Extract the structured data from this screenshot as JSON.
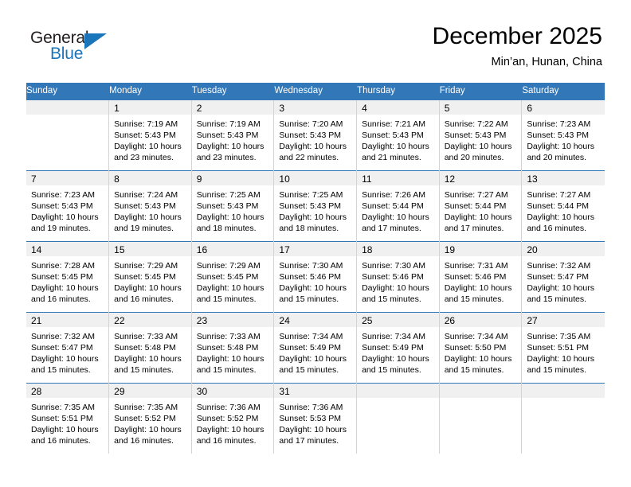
{
  "logo": {
    "text_general": "General",
    "text_blue": "Blue",
    "triangle_color": "#1b75bb"
  },
  "header": {
    "title": "December 2025",
    "subtitle": "Min’an, Hunan, China"
  },
  "theme": {
    "header_row_bg": "#3277b8",
    "daynum_band_bg": "#f0f0f0",
    "grid_line": "#d4d4d4",
    "text": "#000000"
  },
  "weekdays": [
    "Sunday",
    "Monday",
    "Tuesday",
    "Wednesday",
    "Thursday",
    "Friday",
    "Saturday"
  ],
  "weeks": [
    [
      {
        "day": "",
        "sunrise": "",
        "sunset": "",
        "daylight1": "",
        "daylight2": "",
        "empty": true
      },
      {
        "day": "1",
        "sunrise": "Sunrise: 7:19 AM",
        "sunset": "Sunset: 5:43 PM",
        "daylight1": "Daylight: 10 hours",
        "daylight2": "and 23 minutes."
      },
      {
        "day": "2",
        "sunrise": "Sunrise: 7:19 AM",
        "sunset": "Sunset: 5:43 PM",
        "daylight1": "Daylight: 10 hours",
        "daylight2": "and 23 minutes."
      },
      {
        "day": "3",
        "sunrise": "Sunrise: 7:20 AM",
        "sunset": "Sunset: 5:43 PM",
        "daylight1": "Daylight: 10 hours",
        "daylight2": "and 22 minutes."
      },
      {
        "day": "4",
        "sunrise": "Sunrise: 7:21 AM",
        "sunset": "Sunset: 5:43 PM",
        "daylight1": "Daylight: 10 hours",
        "daylight2": "and 21 minutes."
      },
      {
        "day": "5",
        "sunrise": "Sunrise: 7:22 AM",
        "sunset": "Sunset: 5:43 PM",
        "daylight1": "Daylight: 10 hours",
        "daylight2": "and 20 minutes."
      },
      {
        "day": "6",
        "sunrise": "Sunrise: 7:23 AM",
        "sunset": "Sunset: 5:43 PM",
        "daylight1": "Daylight: 10 hours",
        "daylight2": "and 20 minutes."
      }
    ],
    [
      {
        "day": "7",
        "sunrise": "Sunrise: 7:23 AM",
        "sunset": "Sunset: 5:43 PM",
        "daylight1": "Daylight: 10 hours",
        "daylight2": "and 19 minutes."
      },
      {
        "day": "8",
        "sunrise": "Sunrise: 7:24 AM",
        "sunset": "Sunset: 5:43 PM",
        "daylight1": "Daylight: 10 hours",
        "daylight2": "and 19 minutes."
      },
      {
        "day": "9",
        "sunrise": "Sunrise: 7:25 AM",
        "sunset": "Sunset: 5:43 PM",
        "daylight1": "Daylight: 10 hours",
        "daylight2": "and 18 minutes."
      },
      {
        "day": "10",
        "sunrise": "Sunrise: 7:25 AM",
        "sunset": "Sunset: 5:43 PM",
        "daylight1": "Daylight: 10 hours",
        "daylight2": "and 18 minutes."
      },
      {
        "day": "11",
        "sunrise": "Sunrise: 7:26 AM",
        "sunset": "Sunset: 5:44 PM",
        "daylight1": "Daylight: 10 hours",
        "daylight2": "and 17 minutes."
      },
      {
        "day": "12",
        "sunrise": "Sunrise: 7:27 AM",
        "sunset": "Sunset: 5:44 PM",
        "daylight1": "Daylight: 10 hours",
        "daylight2": "and 17 minutes."
      },
      {
        "day": "13",
        "sunrise": "Sunrise: 7:27 AM",
        "sunset": "Sunset: 5:44 PM",
        "daylight1": "Daylight: 10 hours",
        "daylight2": "and 16 minutes."
      }
    ],
    [
      {
        "day": "14",
        "sunrise": "Sunrise: 7:28 AM",
        "sunset": "Sunset: 5:45 PM",
        "daylight1": "Daylight: 10 hours",
        "daylight2": "and 16 minutes."
      },
      {
        "day": "15",
        "sunrise": "Sunrise: 7:29 AM",
        "sunset": "Sunset: 5:45 PM",
        "daylight1": "Daylight: 10 hours",
        "daylight2": "and 16 minutes."
      },
      {
        "day": "16",
        "sunrise": "Sunrise: 7:29 AM",
        "sunset": "Sunset: 5:45 PM",
        "daylight1": "Daylight: 10 hours",
        "daylight2": "and 15 minutes."
      },
      {
        "day": "17",
        "sunrise": "Sunrise: 7:30 AM",
        "sunset": "Sunset: 5:46 PM",
        "daylight1": "Daylight: 10 hours",
        "daylight2": "and 15 minutes."
      },
      {
        "day": "18",
        "sunrise": "Sunrise: 7:30 AM",
        "sunset": "Sunset: 5:46 PM",
        "daylight1": "Daylight: 10 hours",
        "daylight2": "and 15 minutes."
      },
      {
        "day": "19",
        "sunrise": "Sunrise: 7:31 AM",
        "sunset": "Sunset: 5:46 PM",
        "daylight1": "Daylight: 10 hours",
        "daylight2": "and 15 minutes."
      },
      {
        "day": "20",
        "sunrise": "Sunrise: 7:32 AM",
        "sunset": "Sunset: 5:47 PM",
        "daylight1": "Daylight: 10 hours",
        "daylight2": "and 15 minutes."
      }
    ],
    [
      {
        "day": "21",
        "sunrise": "Sunrise: 7:32 AM",
        "sunset": "Sunset: 5:47 PM",
        "daylight1": "Daylight: 10 hours",
        "daylight2": "and 15 minutes."
      },
      {
        "day": "22",
        "sunrise": "Sunrise: 7:33 AM",
        "sunset": "Sunset: 5:48 PM",
        "daylight1": "Daylight: 10 hours",
        "daylight2": "and 15 minutes."
      },
      {
        "day": "23",
        "sunrise": "Sunrise: 7:33 AM",
        "sunset": "Sunset: 5:48 PM",
        "daylight1": "Daylight: 10 hours",
        "daylight2": "and 15 minutes."
      },
      {
        "day": "24",
        "sunrise": "Sunrise: 7:34 AM",
        "sunset": "Sunset: 5:49 PM",
        "daylight1": "Daylight: 10 hours",
        "daylight2": "and 15 minutes."
      },
      {
        "day": "25",
        "sunrise": "Sunrise: 7:34 AM",
        "sunset": "Sunset: 5:49 PM",
        "daylight1": "Daylight: 10 hours",
        "daylight2": "and 15 minutes."
      },
      {
        "day": "26",
        "sunrise": "Sunrise: 7:34 AM",
        "sunset": "Sunset: 5:50 PM",
        "daylight1": "Daylight: 10 hours",
        "daylight2": "and 15 minutes."
      },
      {
        "day": "27",
        "sunrise": "Sunrise: 7:35 AM",
        "sunset": "Sunset: 5:51 PM",
        "daylight1": "Daylight: 10 hours",
        "daylight2": "and 15 minutes."
      }
    ],
    [
      {
        "day": "28",
        "sunrise": "Sunrise: 7:35 AM",
        "sunset": "Sunset: 5:51 PM",
        "daylight1": "Daylight: 10 hours",
        "daylight2": "and 16 minutes."
      },
      {
        "day": "29",
        "sunrise": "Sunrise: 7:35 AM",
        "sunset": "Sunset: 5:52 PM",
        "daylight1": "Daylight: 10 hours",
        "daylight2": "and 16 minutes."
      },
      {
        "day": "30",
        "sunrise": "Sunrise: 7:36 AM",
        "sunset": "Sunset: 5:52 PM",
        "daylight1": "Daylight: 10 hours",
        "daylight2": "and 16 minutes."
      },
      {
        "day": "31",
        "sunrise": "Sunrise: 7:36 AM",
        "sunset": "Sunset: 5:53 PM",
        "daylight1": "Daylight: 10 hours",
        "daylight2": "and 17 minutes."
      },
      {
        "day": "",
        "sunrise": "",
        "sunset": "",
        "daylight1": "",
        "daylight2": "",
        "empty": true
      },
      {
        "day": "",
        "sunrise": "",
        "sunset": "",
        "daylight1": "",
        "daylight2": "",
        "empty": true
      },
      {
        "day": "",
        "sunrise": "",
        "sunset": "",
        "daylight1": "",
        "daylight2": "",
        "empty": true
      }
    ]
  ]
}
